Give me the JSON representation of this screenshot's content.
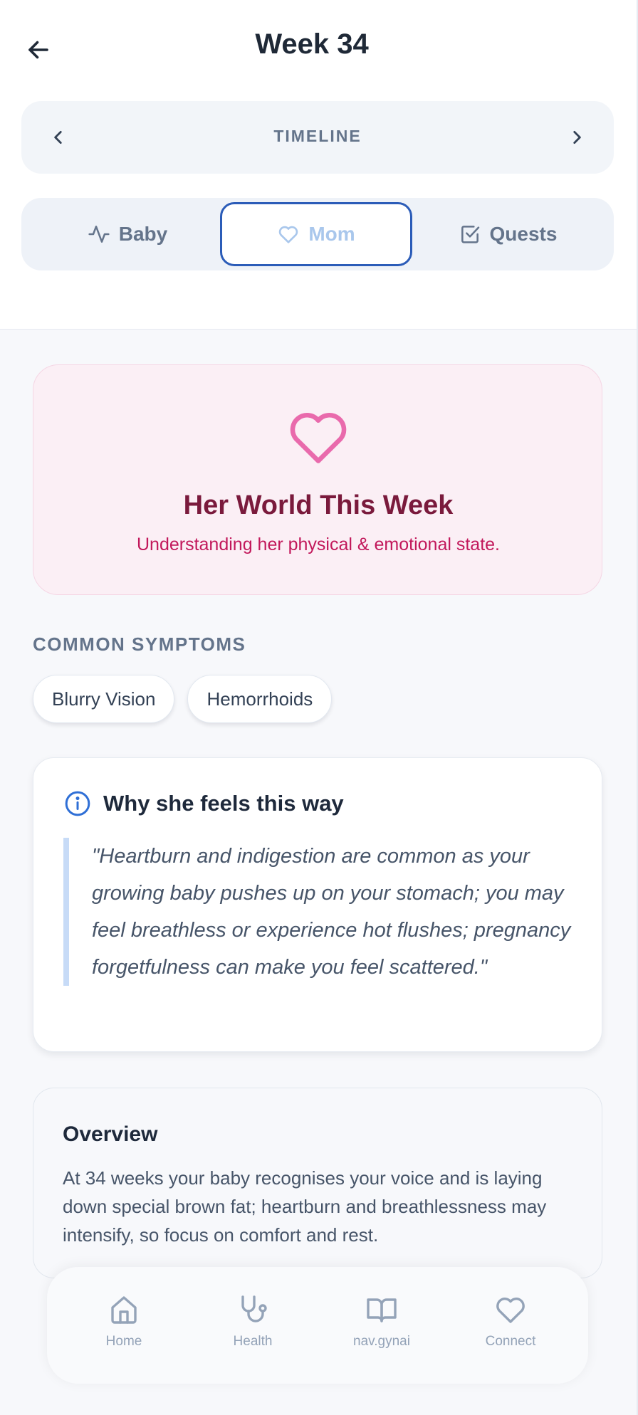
{
  "header": {
    "title": "Week 34"
  },
  "timeline": {
    "label": "TIMELINE"
  },
  "tabs": [
    {
      "label": "Baby",
      "icon": "activity-icon"
    },
    {
      "label": "Mom",
      "icon": "heart-icon",
      "selected": true
    },
    {
      "label": "Quests",
      "icon": "checkbox-icon"
    }
  ],
  "hero": {
    "icon": "heart-icon",
    "title": "Her World This Week",
    "subtitle": "Understanding her physical & emotional state."
  },
  "symptoms": {
    "heading": "COMMON SYMPTOMS",
    "items": [
      "Blurry Vision",
      "Hemorrhoids"
    ]
  },
  "why": {
    "icon": "info-icon",
    "title": "Why she feels this way",
    "quote": "\"Heartburn and indigestion are common as your growing baby pushes up on your stomach; you may feel breathless or experience hot flushes; pregnancy forgetfulness can make you feel scattered.\""
  },
  "overview": {
    "title": "Overview",
    "text": "At 34 weeks your baby recognises your voice and is laying down special brown fat; heartburn and breathlessness may intensify, so focus on comfort and rest."
  },
  "nav": [
    {
      "label": "Home",
      "icon": "home-icon"
    },
    {
      "label": "Health",
      "icon": "stethoscope-icon"
    },
    {
      "label": "nav.gynai",
      "icon": "book-icon"
    },
    {
      "label": "Connect",
      "icon": "heart-icon"
    }
  ],
  "colors": {
    "accent_blue": "#2b5cb8",
    "hero_bg": "#fbeff5",
    "hero_title": "#7a1a3c",
    "hero_subtitle": "#c2185b",
    "heart_pink": "#e96aac"
  }
}
